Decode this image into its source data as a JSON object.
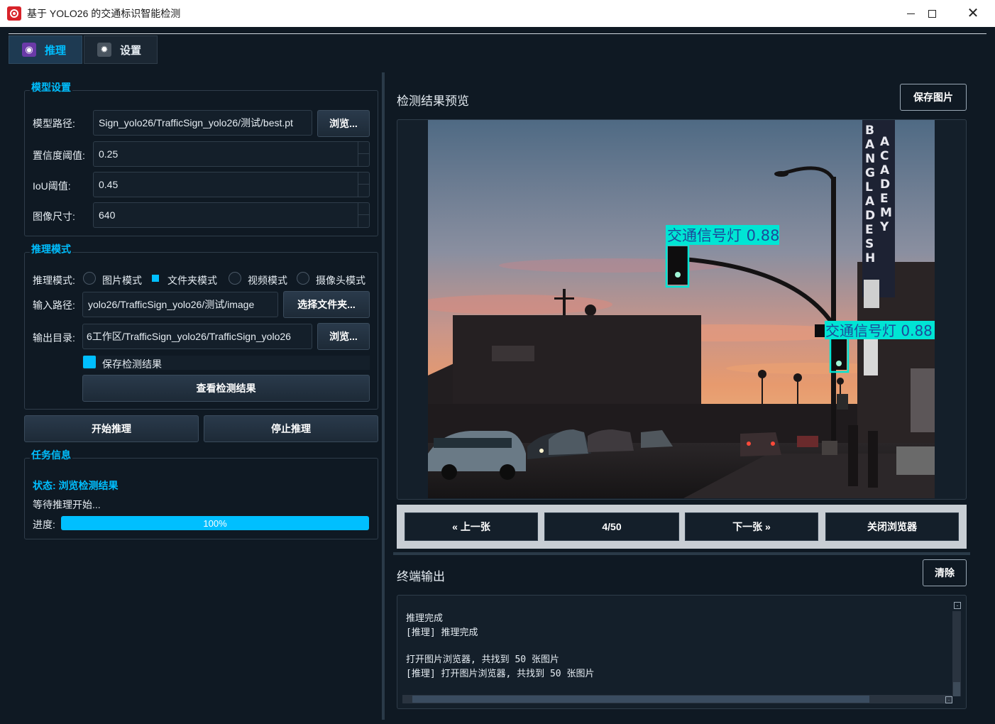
{
  "window": {
    "title": "基于 YOLO26 的交通标识智能检测"
  },
  "tabs": [
    {
      "label": "推理",
      "icon": "brain-icon",
      "active": true
    },
    {
      "label": "设置",
      "icon": "gear-icon",
      "active": false
    }
  ],
  "model_settings": {
    "group_title": "模型设置",
    "model_path_label": "模型路径:",
    "model_path_value": "Sign_yolo26/TrafficSign_yolo26/测试/best.pt",
    "browse_label": "浏览...",
    "conf_label": "置信度阈值:",
    "conf_value": "0.25",
    "iou_label": "IoU阈值:",
    "iou_value": "0.45",
    "imgsz_label": "图像尺寸:",
    "imgsz_value": "640"
  },
  "infer_mode": {
    "group_title": "推理模式",
    "mode_label": "推理模式:",
    "modes": [
      "图片模式",
      "文件夹模式",
      "视频模式",
      "摄像头模式"
    ],
    "selected_mode": "文件夹模式",
    "input_label": "输入路径:",
    "input_value": "yolo26/TrafficSign_yolo26/测试/image",
    "select_folder_label": "选择文件夹...",
    "output_label": "输出目录:",
    "output_value": "6工作区/TrafficSign_yolo26/TrafficSign_yolo26",
    "browse_label": "浏览...",
    "save_results_label": "保存检测结果",
    "save_results_checked": true,
    "view_results_label": "查看检测结果"
  },
  "actions": {
    "start_label": "开始推理",
    "stop_label": "停止推理"
  },
  "task_info": {
    "group_title": "任务信息",
    "status_text": "状态: 浏览检测结果",
    "message": "等待推理开始...",
    "progress_label": "进度:",
    "progress_value": 100,
    "progress_text": "100%"
  },
  "preview": {
    "title": "检测结果预览",
    "save_label": "保存图片",
    "detections": [
      {
        "label": "交通信号灯 0.88"
      },
      {
        "label": "交通信号灯 0.88"
      }
    ],
    "sign_text": [
      "BANGLADESH",
      "ACADEMY"
    ],
    "prev_label": "« 上一张",
    "counter": "4/50",
    "next_label": "下一张 »",
    "close_label": "关闭浏览器"
  },
  "terminal": {
    "title": "终端输出",
    "clear_label": "清除",
    "lines": [
      "推理完成",
      "[推理] 推理完成",
      "",
      "打开图片浏览器, 共找到 50 张图片",
      "[推理] 打开图片浏览器, 共找到 50 张图片"
    ]
  },
  "colors": {
    "accent": "#00bfff",
    "background": "#0f1923",
    "detection_box": "#00e5d4"
  }
}
